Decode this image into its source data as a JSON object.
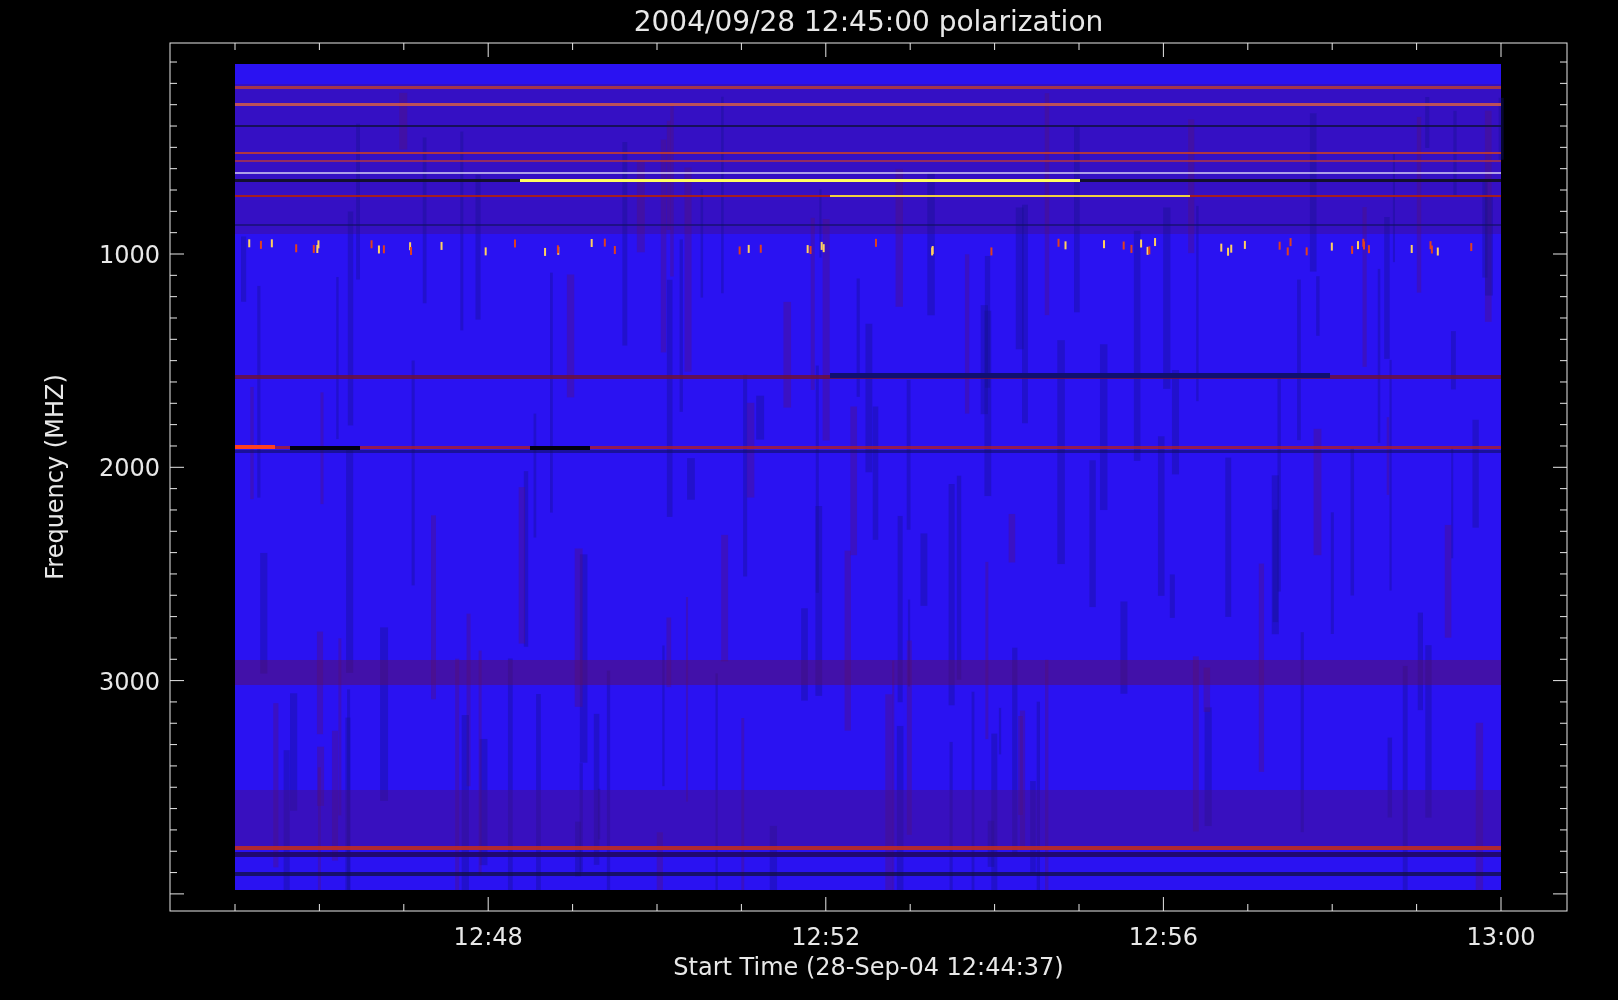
{
  "title": "2004/09/28 12:45:00 polarization",
  "ylabel": "Frequency (MHZ)",
  "xlabel": "Start Time (28-Sep-04 12:44:37)",
  "xticks": [
    "12:48",
    "12:52",
    "12:56",
    "13:00"
  ],
  "yticks": [
    "1000",
    "2000",
    "3000"
  ]
}
